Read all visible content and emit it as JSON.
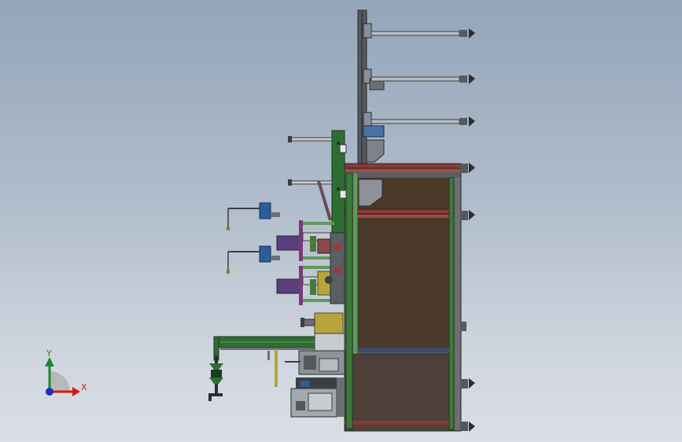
{
  "viewport": {
    "background_top": "#93a5b9",
    "background_bottom": "#dadfe6"
  },
  "model": {
    "description_icon": "machine-assembly-side-view",
    "colors": {
      "frame_gray": "#7d858c",
      "frame_dark": "#3c3f43",
      "brown_panel": "#4a3828",
      "red_rail": "#8a3a36",
      "green_frame": "#2f6e33",
      "light_green": "#6fa36a",
      "motor_blue": "#2c5d9a",
      "motor_purple": "#5a3f7a",
      "yellow_block": "#b7a43a"
    }
  },
  "triad": {
    "x_label": "X",
    "y_label": "Y",
    "x_color": "#d81818",
    "y_color": "#1c8a2a",
    "z_color": "#1a2fb5"
  }
}
